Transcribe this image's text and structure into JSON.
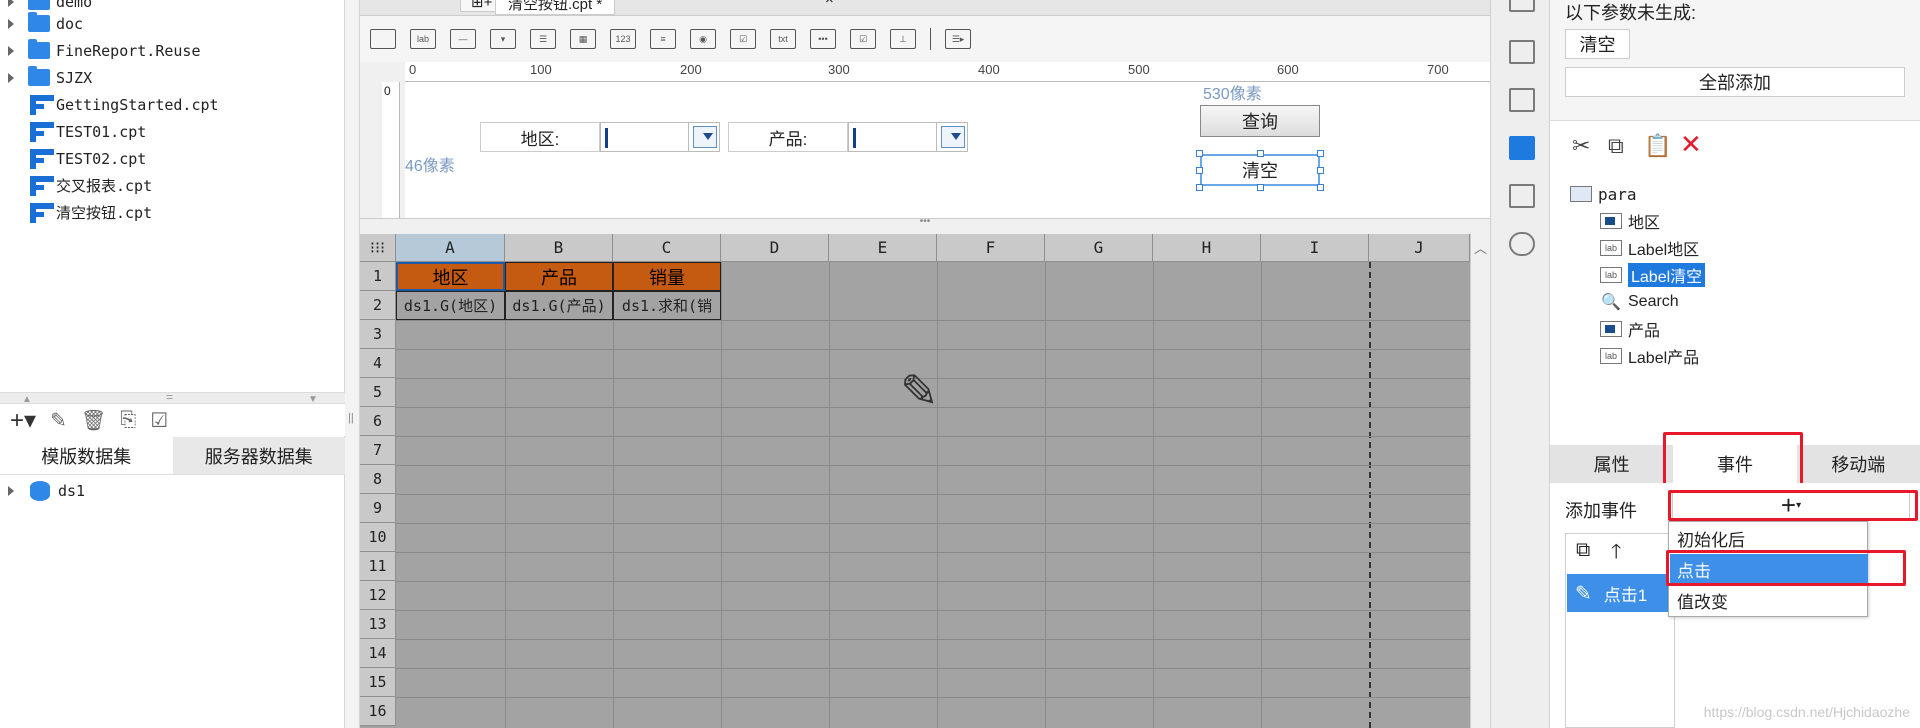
{
  "left_panel": {
    "tree": [
      {
        "type": "folder",
        "label": "demo"
      },
      {
        "type": "folder",
        "label": "doc"
      },
      {
        "type": "folder",
        "label": "FineReport.Reuse"
      },
      {
        "type": "folder",
        "label": "SJZX"
      },
      {
        "type": "file",
        "label": "GettingStarted.cpt"
      },
      {
        "type": "file",
        "label": "TEST01.cpt"
      },
      {
        "type": "file",
        "label": "TEST02.cpt"
      },
      {
        "type": "file",
        "label": "交叉报表.cpt"
      },
      {
        "type": "file",
        "label": "清空按钮.cpt"
      }
    ],
    "ds_tabs": [
      "模版数据集",
      "服务器数据集"
    ],
    "datasets": [
      "ds1"
    ]
  },
  "editor": {
    "tab_title": "清空按钮.cpt *",
    "ruler_ticks": [
      "0",
      "100",
      "200",
      "300",
      "400",
      "500",
      "600",
      "700"
    ],
    "ruler_left_zero": "0",
    "param_pane": {
      "label_region": "地区:",
      "label_product": "产品:",
      "query_button": "查询",
      "clear_button": "清空",
      "width_hint": "530像素",
      "height_hint": "46像素"
    }
  },
  "sheet": {
    "columns": [
      "A",
      "B",
      "C",
      "D",
      "E",
      "F",
      "G",
      "H",
      "I",
      "J"
    ],
    "rows": [
      "1",
      "2",
      "3",
      "4",
      "5",
      "6",
      "7",
      "8",
      "9",
      "10",
      "11",
      "12",
      "13",
      "14",
      "15",
      "16"
    ],
    "header_cells": [
      "地区",
      "产品",
      "销量"
    ],
    "data_cells": [
      "ds1.G(地区)",
      "ds1.G(产品)",
      "ds1.求和(销"
    ]
  },
  "right_panel": {
    "missing_params_label": "以下参数未生成:",
    "missing_param_item": "清空",
    "add_all_button": "全部添加",
    "widget_tree": {
      "root": "para",
      "items": [
        "地区",
        "Label地区",
        "Label清空",
        "Search",
        "产品",
        "Label产品"
      ],
      "selected": "Label清空"
    },
    "tabs": [
      "属性",
      "事件",
      "移动端"
    ],
    "active_tab": "事件",
    "add_event_label": "添加事件",
    "add_event_button": "+",
    "event_list": [
      "点击1"
    ],
    "dropdown": [
      "初始化后",
      "点击",
      "值改变"
    ],
    "dropdown_highlight": "点击"
  },
  "watermark": "https://blog.csdn.net/Hjchidaozhe",
  "colors": {
    "header_cell": "#c55a11",
    "grid_bg": "#a3a3a3",
    "accent": "#1f7ae0",
    "highlight_box": "#e8182b"
  }
}
